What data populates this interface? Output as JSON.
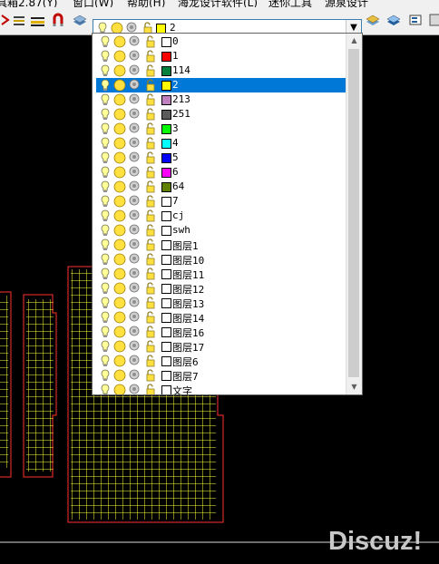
{
  "menubar": {
    "items": [
      "具箱2.87(Y)",
      "窗口(W)",
      "帮助(H)",
      "海龙设计软件(L)",
      "迷你工具",
      "源泉设计"
    ]
  },
  "layer_combo": {
    "value": "2",
    "value_color": "#ffff00"
  },
  "layer_list": {
    "selected_index": 3,
    "layers": [
      {
        "name": "0",
        "color": "#ffffff"
      },
      {
        "name": "1",
        "color": "#ff0000"
      },
      {
        "name": "114",
        "color": "#00803c"
      },
      {
        "name": "2",
        "color": "#ffff00"
      },
      {
        "name": "213",
        "color": "#c080c0"
      },
      {
        "name": "251",
        "color": "#5a5a5a"
      },
      {
        "name": "3",
        "color": "#00ff00"
      },
      {
        "name": "4",
        "color": "#00ffff"
      },
      {
        "name": "5",
        "color": "#0000ff"
      },
      {
        "name": "6",
        "color": "#ff00ff"
      },
      {
        "name": "64",
        "color": "#608000"
      },
      {
        "name": "7",
        "color": "#ffffff"
      },
      {
        "name": "cj",
        "color": "#ffffff"
      },
      {
        "name": "swh",
        "color": "#ffffff"
      },
      {
        "name": "图层1",
        "color": "#ffffff"
      },
      {
        "name": "图层10",
        "color": "#ffffff"
      },
      {
        "name": "图层11",
        "color": "#ffffff"
      },
      {
        "name": "图层12",
        "color": "#ffffff"
      },
      {
        "name": "图层13",
        "color": "#ffffff"
      },
      {
        "name": "图层14",
        "color": "#ffffff"
      },
      {
        "name": "图层16",
        "color": "#ffffff"
      },
      {
        "name": "图层17",
        "color": "#ffffff"
      },
      {
        "name": "图层6",
        "color": "#ffffff"
      },
      {
        "name": "图层7",
        "color": "#ffffff"
      },
      {
        "name": "文字",
        "color": "#ffffff"
      }
    ]
  },
  "watermark": "Discuz!"
}
